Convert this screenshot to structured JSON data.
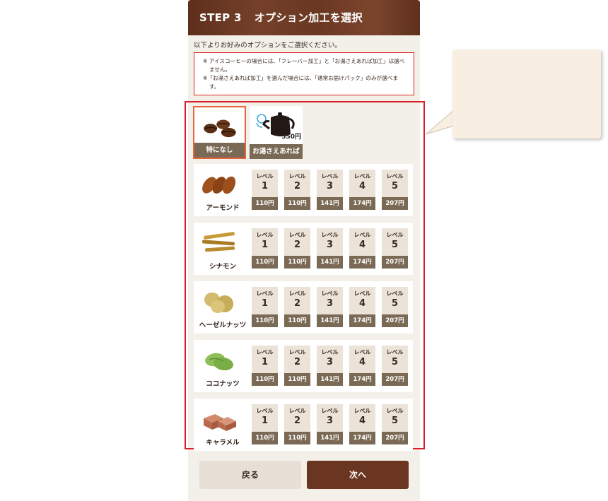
{
  "header": {
    "step": "STEP 3",
    "title": "オプション加工を選択"
  },
  "intro": "以下よりお好みのオプションをご選択ください。",
  "notices": [
    "※ アイスコーヒーの場合には、「フレーバー加工」と「お湯さえあれば加工」は選べません。",
    "※「お湯さえあれば加工」を選んだ場合には、「通常お届けパック」のみが選べます。"
  ],
  "top_options": [
    {
      "label": "特になし",
      "icon": "coffee-beans-icon",
      "selected": true
    },
    {
      "label": "お湯さえあれば",
      "icon": "kettle-icon",
      "price": "550円",
      "selected": false
    }
  ],
  "level_word": "レベル",
  "flavors": [
    {
      "name": "アーモンド",
      "icon": "almond-icon",
      "levels": [
        {
          "num": "1",
          "price": "110円"
        },
        {
          "num": "2",
          "price": "110円"
        },
        {
          "num": "3",
          "price": "141円"
        },
        {
          "num": "4",
          "price": "174円"
        },
        {
          "num": "5",
          "price": "207円"
        }
      ]
    },
    {
      "name": "シナモン",
      "icon": "cinnamon-icon",
      "levels": [
        {
          "num": "1",
          "price": "110円"
        },
        {
          "num": "2",
          "price": "110円"
        },
        {
          "num": "3",
          "price": "141円"
        },
        {
          "num": "4",
          "price": "174円"
        },
        {
          "num": "5",
          "price": "207円"
        }
      ]
    },
    {
      "name": "ヘーゼルナッツ",
      "icon": "hazelnut-icon",
      "levels": [
        {
          "num": "1",
          "price": "110円"
        },
        {
          "num": "2",
          "price": "110円"
        },
        {
          "num": "3",
          "price": "141円"
        },
        {
          "num": "4",
          "price": "174円"
        },
        {
          "num": "5",
          "price": "207円"
        }
      ]
    },
    {
      "name": "ココナッツ",
      "icon": "coconut-icon",
      "levels": [
        {
          "num": "1",
          "price": "110円"
        },
        {
          "num": "2",
          "price": "110円"
        },
        {
          "num": "3",
          "price": "141円"
        },
        {
          "num": "4",
          "price": "174円"
        },
        {
          "num": "5",
          "price": "207円"
        }
      ]
    },
    {
      "name": "キャラメル",
      "icon": "caramel-icon",
      "levels": [
        {
          "num": "1",
          "price": "110円"
        },
        {
          "num": "2",
          "price": "110円"
        },
        {
          "num": "3",
          "price": "141円"
        },
        {
          "num": "4",
          "price": "174円"
        },
        {
          "num": "5",
          "price": "207円"
        }
      ]
    }
  ],
  "buttons": {
    "back": "戻る",
    "next": "次へ"
  },
  "colors": {
    "header_brown": "#6a3722",
    "label_brown": "#7a6a55",
    "highlight_red": "#d81f26",
    "selected_orange": "#e8643c",
    "next_brown": "#6a3621"
  }
}
